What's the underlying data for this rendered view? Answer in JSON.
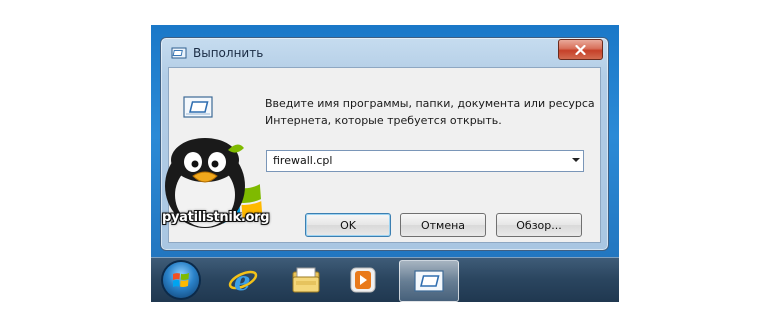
{
  "window": {
    "title": "Выполнить",
    "prompt": "Введите имя программы, папки, документа или ресурса Интернета, которые требуется открыть.",
    "command_value": "firewall.cpl",
    "buttons": {
      "ok": "OK",
      "cancel": "Отмена",
      "browse": "Обзор..."
    }
  },
  "taskbar": {
    "items": [
      "start-orb",
      "internet-explorer-icon",
      "windows-explorer-icon",
      "media-player-icon",
      "run-dialog-icon"
    ]
  },
  "watermark": {
    "text": "pyatilistnik.org"
  },
  "colors": {
    "close_button": "#c64028",
    "desktop": "#1f6fb8",
    "taskbar": "#2b4660"
  }
}
